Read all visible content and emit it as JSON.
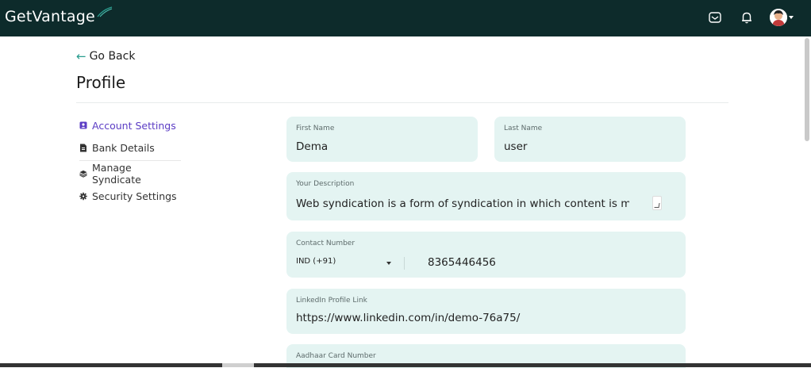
{
  "app": {
    "brand": "GetVantage"
  },
  "header": {
    "icons": [
      "mail-icon",
      "bell-icon",
      "user-avatar"
    ]
  },
  "page": {
    "back_label": "Go Back",
    "title": "Profile"
  },
  "sidebar": {
    "items": [
      {
        "label": "Account Settings",
        "icon": "account-icon",
        "active": true
      },
      {
        "label": "Bank Details",
        "icon": "document-icon",
        "active": false
      },
      {
        "label": "Manage Syndicate",
        "icon": "layers-icon",
        "active": false
      },
      {
        "label": "Security Settings",
        "icon": "gear-icon",
        "active": false
      }
    ]
  },
  "form": {
    "first_name": {
      "label": "First Name",
      "value": "Dema"
    },
    "last_name": {
      "label": "Last Name",
      "value": "user"
    },
    "description": {
      "label": "Your Description",
      "value": "Web syndication is a form of syndication in which content is made"
    },
    "contact": {
      "label": "Contact Number",
      "country": "IND (+91)",
      "value": "8365446456"
    },
    "linkedin": {
      "label": "LinkedIn Profile Link",
      "value": "https://www.linkedin.com/in/demo-76a75/"
    },
    "aadhaar": {
      "label": "Aadhaar Card Number",
      "value": ""
    }
  },
  "colors": {
    "header_bg": "#0d2b2b",
    "field_bg": "#e4f4f2",
    "active_nav": "#5b3cc4",
    "accent": "#2a9d8f"
  }
}
